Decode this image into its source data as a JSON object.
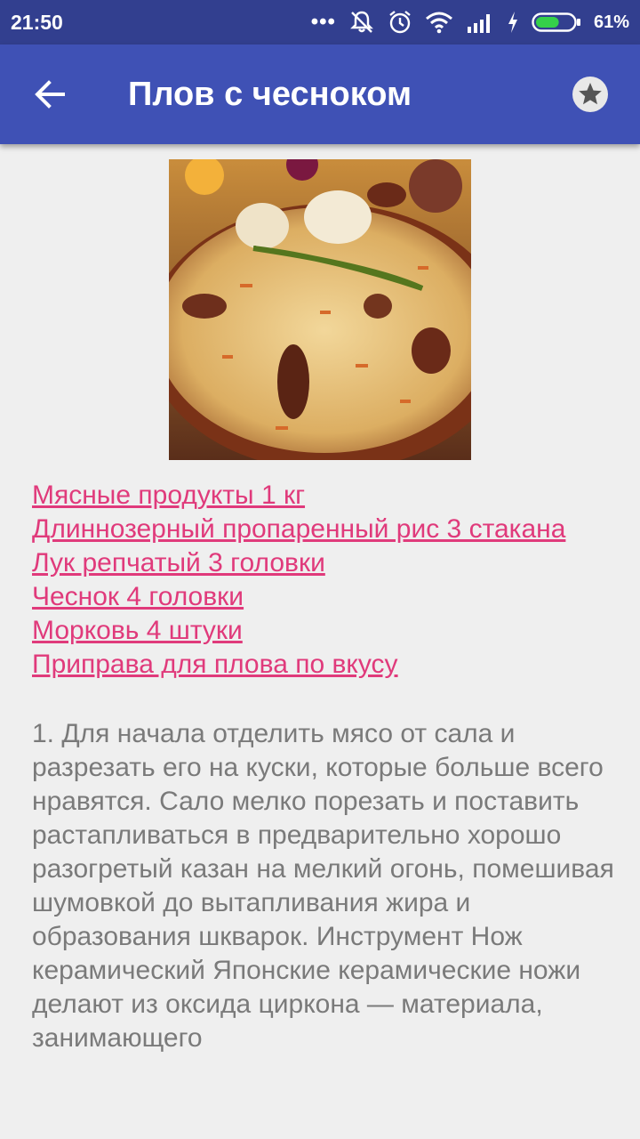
{
  "status_bar": {
    "time": "21:50",
    "dots": "•••",
    "battery_percent": "61%",
    "battery_level": 0.61,
    "icons": [
      "silent-mode-icon",
      "alarm-icon",
      "wifi-icon",
      "cell-signal-icon",
      "charging-icon",
      "battery-icon"
    ]
  },
  "app_bar": {
    "title": "Плов с чесноком",
    "back_icon": "arrow-back-icon",
    "favorite_icon": "star-icon",
    "color": "#3f51b5"
  },
  "ingredients": [
    "Мясные продукты 1 кг",
    "Длиннозерный пропаренный рис 3 стакана",
    "Лук репчатый 3 головки",
    "Чеснок 4 головки",
    "Морковь 4 штуки",
    "Приправа для плова по вкусу"
  ],
  "link_color": "#e03a7b",
  "steps": [
    "1. Для начала отделить мясо от сала и разрезать его на куски, которые больше всего нравятся. Сало мелко порезать и поставить растапливаться в предварительно хорошо разогретый казан на мелкий огонь, помешивая шумовкой до вытапливания жира и образования шкварок. Инструмент Нож керамический Японские керамические ножи делают из оксида циркона — материала, занимающего"
  ]
}
